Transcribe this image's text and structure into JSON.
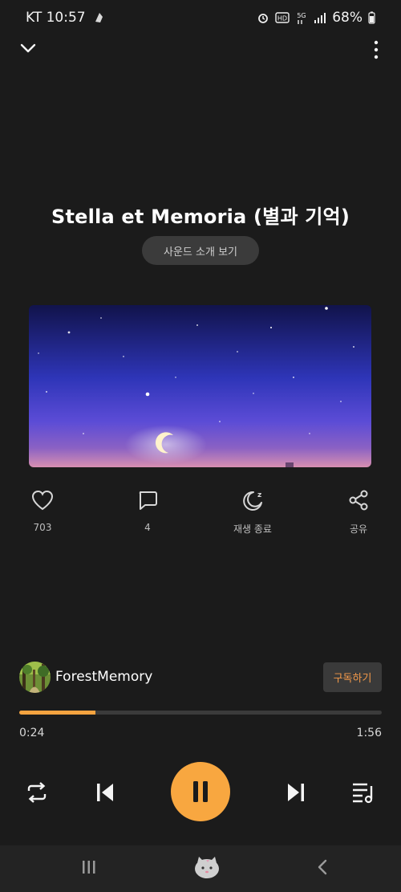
{
  "status_bar": {
    "carrier_time": "KT 10:57",
    "battery": "68%"
  },
  "track": {
    "title": "Stella et Memoria (별과 기억)",
    "intro_button": "사운드 소개 보기"
  },
  "actions": [
    {
      "name": "like",
      "label": "703",
      "icon": "heart-icon"
    },
    {
      "name": "comment",
      "label": "4",
      "icon": "comment-icon"
    },
    {
      "name": "sleep-timer",
      "label": "재생 종료",
      "icon": "moon-icon"
    },
    {
      "name": "share",
      "label": "공유",
      "icon": "share-icon"
    }
  ],
  "channel": {
    "name": "ForestMemory",
    "subscribe_label": "구독하기"
  },
  "playback": {
    "current_time": "0:24",
    "duration": "1:56",
    "progress": 0.21
  },
  "colors": {
    "accent": "#f8a740",
    "background": "#1b1b1b"
  },
  "controls": [
    "repeat-icon",
    "previous-icon",
    "pause-icon",
    "next-icon",
    "playlist-icon"
  ],
  "navbar": [
    "recent-apps-icon",
    "home-icon",
    "back-icon"
  ]
}
